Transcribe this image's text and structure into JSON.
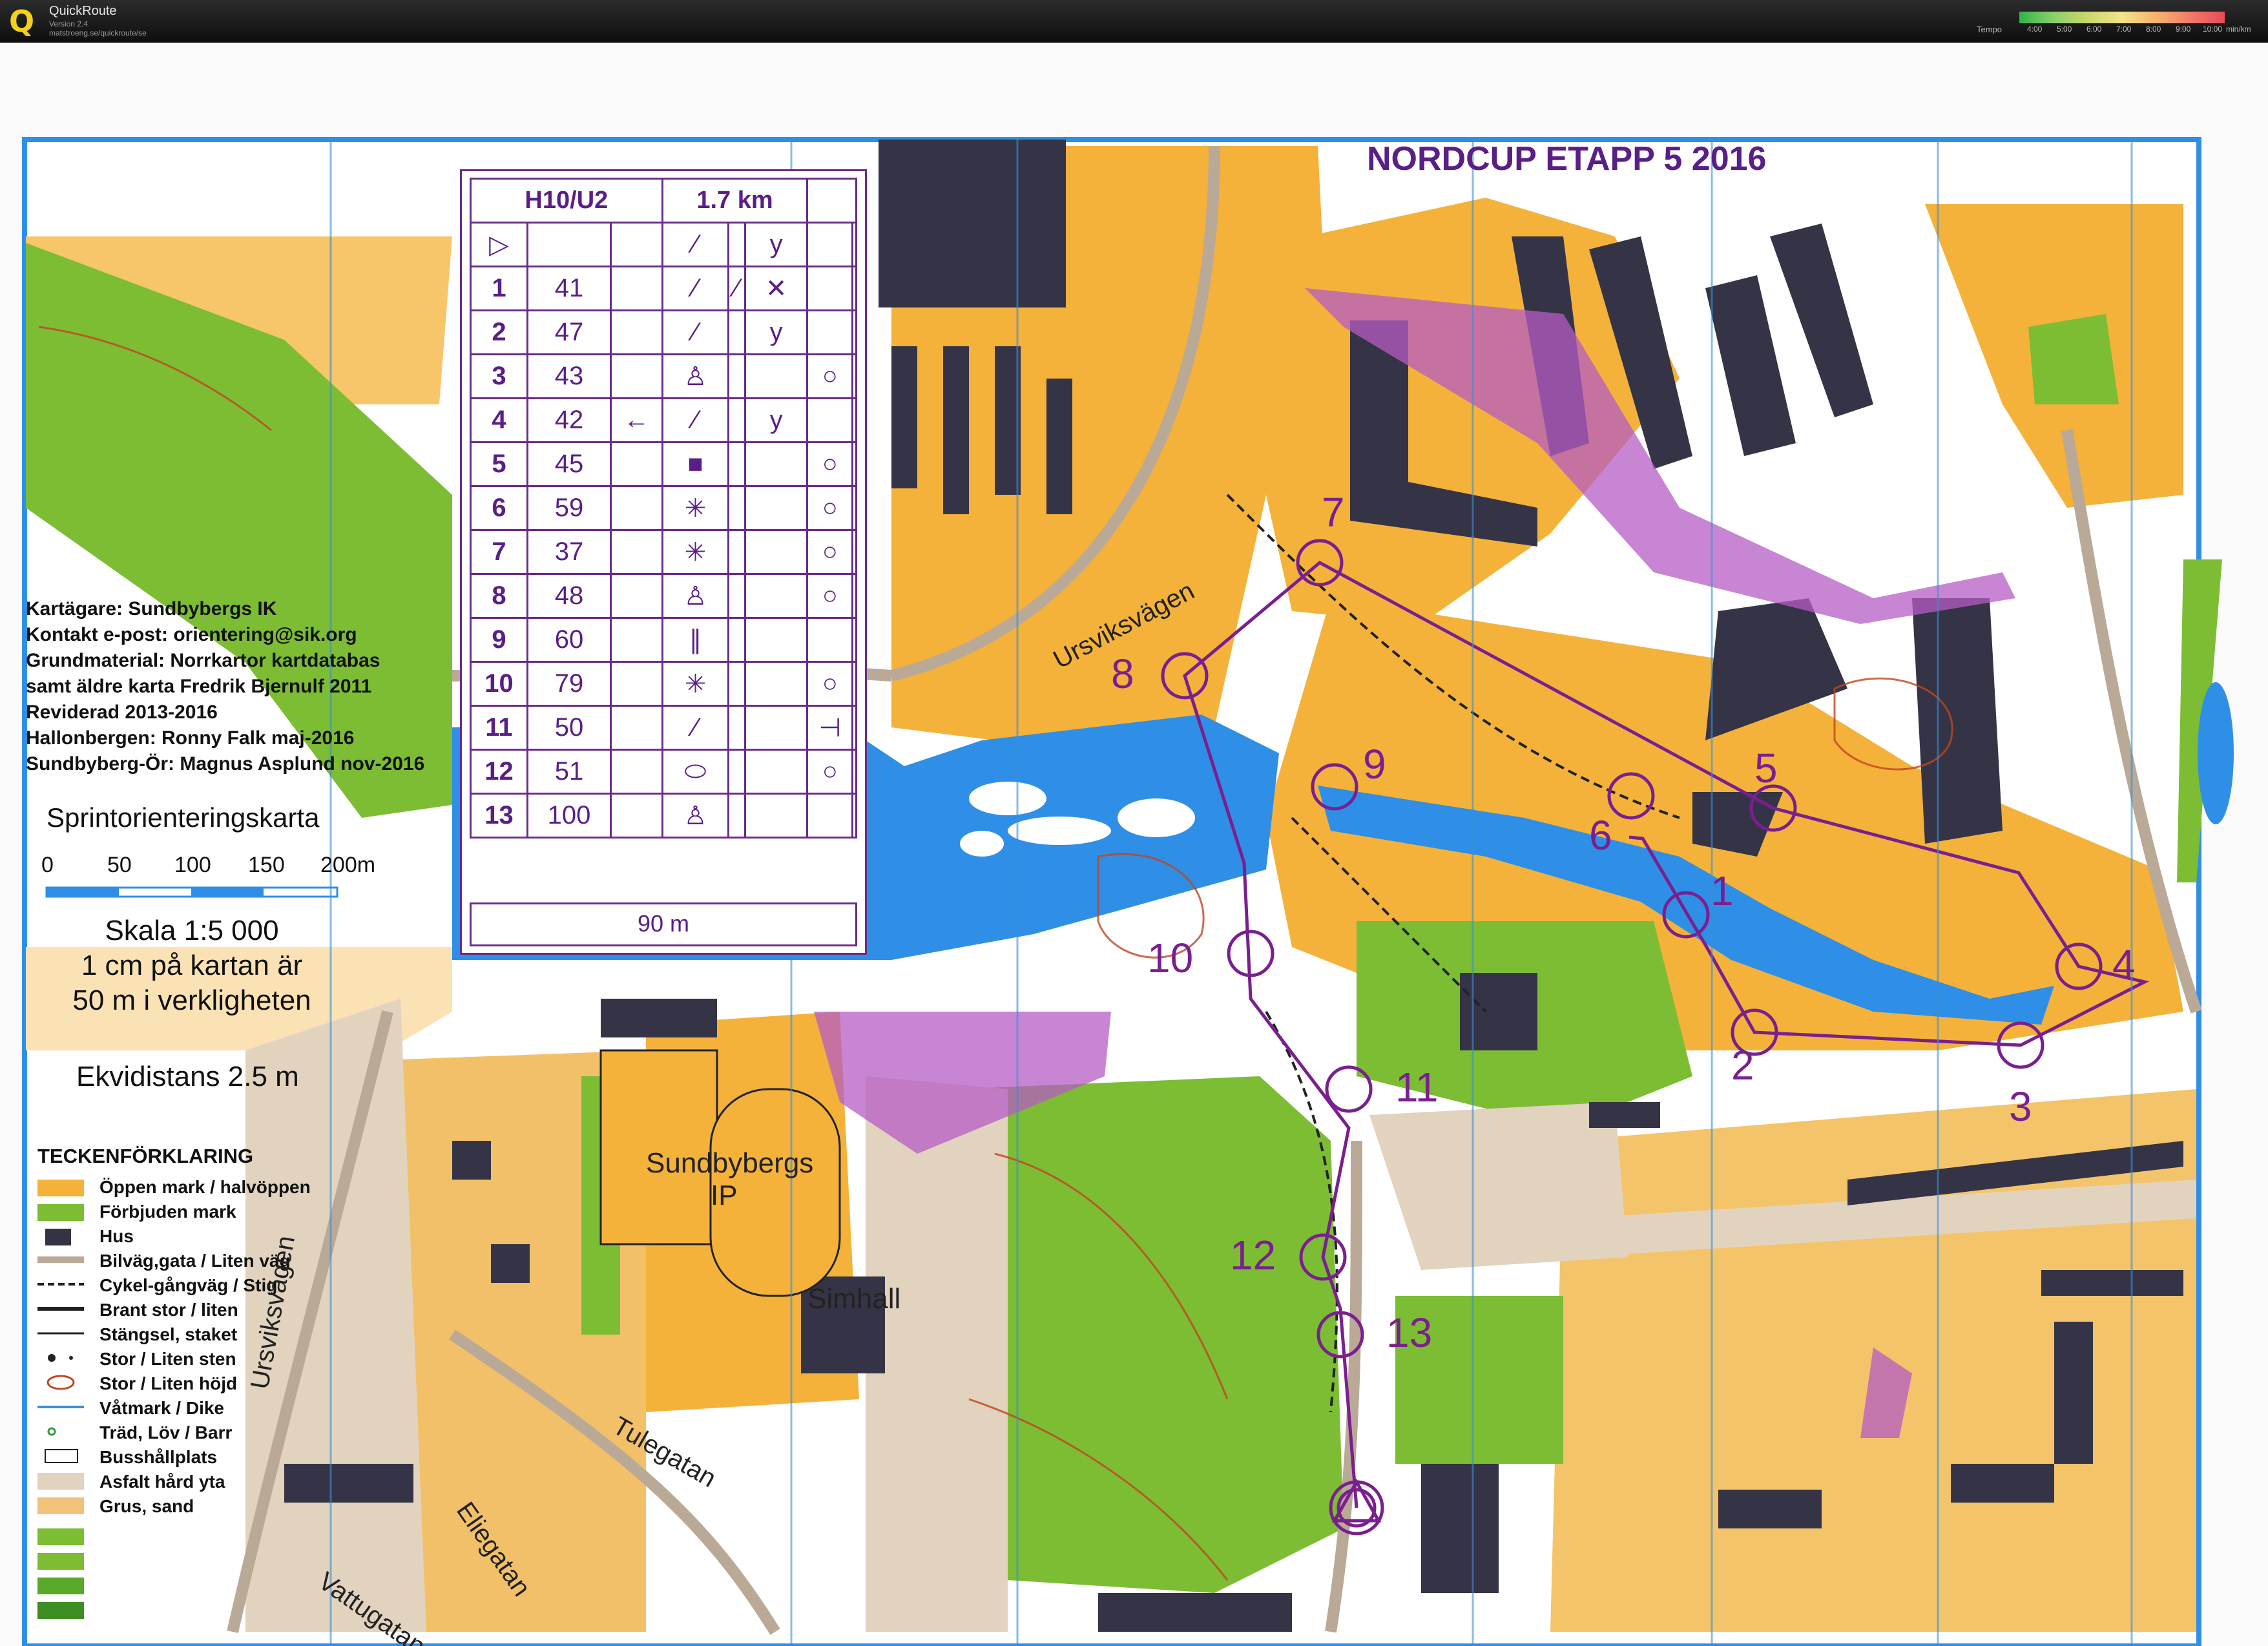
{
  "app": {
    "name": "QuickRoute",
    "version": "Version 2.4",
    "url": "matstroeng.se/quickroute/se"
  },
  "tempo": {
    "label": "Tempo",
    "ticks": [
      "4:00",
      "5:00",
      "6:00",
      "7:00",
      "8:00",
      "9:00",
      "10:00"
    ],
    "unit": "min/km"
  },
  "map": {
    "title": "NORDCUP ETAPP 5 2016",
    "credits": [
      "Kartägare: Sundbybergs IK",
      "Kontakt e-post: orientering@sik.org",
      "Grundmaterial: Norrkartor kartdatabas",
      "samt äldre karta Fredrik Bjernulf 2011",
      "Reviderad 2013-2016",
      "Hallonbergen: Ronny Falk maj-2016",
      "Sundbyberg-Ör: Magnus Asplund nov-2016"
    ],
    "map_type": "Sprintorienteringskarta",
    "scale_ticks": [
      "0",
      "50",
      "100",
      "150",
      "200m"
    ],
    "scale_lines": [
      "Skala 1:5 000",
      "1 cm på kartan är",
      "50 m i verkligheten"
    ],
    "contour_interval": "Ekvidistans 2.5 m",
    "legend_title": "TECKENFÖRKLARING",
    "legend": [
      {
        "label": "Öppen mark / halvöppen",
        "color": "#f4b23a"
      },
      {
        "label": "Förbjuden mark",
        "color": "#7cbd34"
      },
      {
        "label": "Hus",
        "color": "#333344"
      },
      {
        "label": "Bilväg,gata / Liten väg",
        "color": "#d6c7b4"
      },
      {
        "label": "Cykel-gångväg / Stig",
        "color": "#222222"
      },
      {
        "label": "Brant stor / liten",
        "color": "#222222"
      },
      {
        "label": "Stängsel, staket",
        "color": "#222222"
      },
      {
        "label": "Stor / Liten sten",
        "color": "#222222"
      },
      {
        "label": "Stor / Liten höjd",
        "color": "#c0451f"
      },
      {
        "label": "Våtmark / Dike",
        "color": "#3b8fd6"
      },
      {
        "label": "Träd, Löv / Barr",
        "color": "#2f9b3a"
      },
      {
        "label": "Busshållplats",
        "color": "#ffffff"
      },
      {
        "label": "Asfalt hård yta",
        "color": "#e2d3bf"
      },
      {
        "label": "Grus, sand",
        "color": "#f2c27a"
      }
    ],
    "street_names": [
      "Ursviksvägen",
      "Ursviksvägen",
      "Tulegatan",
      "Eliegatan",
      "Vattugatan"
    ],
    "place_names": [
      "Sundbybergs",
      "IP",
      "Simhall"
    ],
    "colors": {
      "open": "#f4b23a",
      "forbidden": "#7cbd34",
      "building": "#343446",
      "water": "#2f8fe6",
      "course": "#7a1f8f",
      "paved": "#e2d3bf"
    }
  },
  "course": {
    "class": "H10/U2",
    "length": "1.7 km",
    "finish_distance": "90 m",
    "controls": [
      {
        "num": "1",
        "code": "41"
      },
      {
        "num": "2",
        "code": "47"
      },
      {
        "num": "3",
        "code": "43"
      },
      {
        "num": "4",
        "code": "42"
      },
      {
        "num": "5",
        "code": "45"
      },
      {
        "num": "6",
        "code": "59"
      },
      {
        "num": "7",
        "code": "37"
      },
      {
        "num": "8",
        "code": "48"
      },
      {
        "num": "9",
        "code": "60"
      },
      {
        "num": "10",
        "code": "79"
      },
      {
        "num": "11",
        "code": "50"
      },
      {
        "num": "12",
        "code": "51"
      },
      {
        "num": "13",
        "code": "100"
      }
    ],
    "map_labels": [
      "1",
      "2",
      "3",
      "4",
      "5",
      "6",
      "7",
      "8",
      "9",
      "10",
      "11",
      "12",
      "13"
    ]
  }
}
